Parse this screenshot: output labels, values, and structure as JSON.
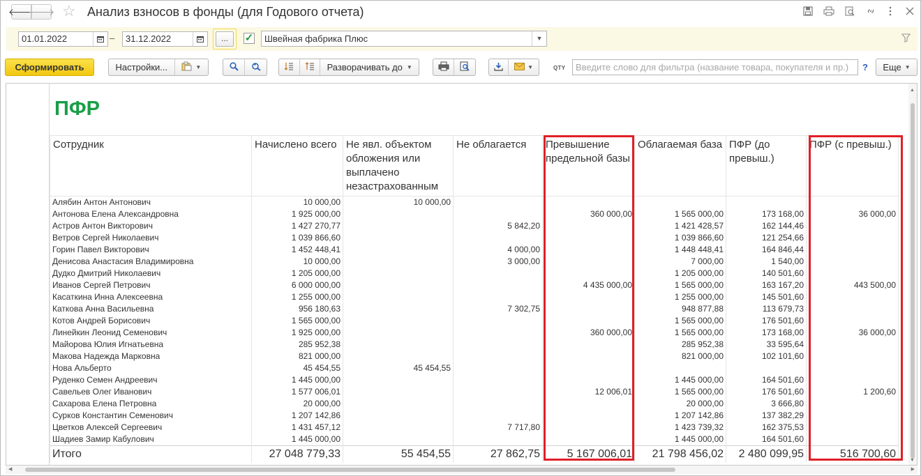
{
  "window": {
    "title": "Анализ взносов в фонды (для Годового отчета)",
    "back_glyph": "🡐",
    "forward_glyph": "🡒",
    "star_glyph": "☆",
    "icons": [
      "save-icon",
      "print-icon",
      "preview-icon",
      "link-icon",
      "more-icon",
      "close-icon"
    ]
  },
  "params": {
    "date_from": "01.01.2022",
    "date_to": "31.12.2022",
    "dash": "–",
    "dots_label": "...",
    "org_checked": "✓",
    "organization": "Швейная фабрика Плюс"
  },
  "toolbar": {
    "generate_label": "Сформировать",
    "settings_label": "Настройки...",
    "expand_label": "Разворачивать до",
    "qty_label": "QTY",
    "search_placeholder": "Введите слово для фильтра (название товара, покупателя и пр.)",
    "help_label": "?",
    "more_label": "Еще"
  },
  "report": {
    "section_title": "ПФР",
    "columns": [
      "Сотрудник",
      "Начислено всего",
      "Не явл. объектом обложения или выплачено незастрахованным",
      "Не облагается",
      "Превышение предельной базы",
      "Облагаемая база",
      "ПФР (до превыш.)",
      "ПФР (с превыш.)"
    ],
    "rows": [
      [
        "Алябин Антон Антонович",
        "10 000,00",
        "10 000,00",
        "",
        "",
        "",
        "",
        ""
      ],
      [
        "Антонова Елена Александровна",
        "1 925 000,00",
        "",
        "",
        "360 000,00",
        "1 565 000,00",
        "173 168,00",
        "36 000,00"
      ],
      [
        "Астров Антон Викторович",
        "1 427 270,77",
        "",
        "5 842,20",
        "",
        "1 421 428,57",
        "162 144,46",
        ""
      ],
      [
        "Ветров Сергей Николаевич",
        "1 039 866,60",
        "",
        "",
        "",
        "1 039 866,60",
        "121 254,66",
        ""
      ],
      [
        "Горин Павел Викторович",
        "1 452 448,41",
        "",
        "4 000,00",
        "",
        "1 448 448,41",
        "164 846,44",
        ""
      ],
      [
        "Денисова Анастасия Владимировна",
        "10 000,00",
        "",
        "3 000,00",
        "",
        "7 000,00",
        "1 540,00",
        ""
      ],
      [
        "Дудко Дмитрий Николаевич",
        "1 205 000,00",
        "",
        "",
        "",
        "1 205 000,00",
        "140 501,60",
        ""
      ],
      [
        "Иванов Сергей Петрович",
        "6 000 000,00",
        "",
        "",
        "4 435 000,00",
        "1 565 000,00",
        "163 167,20",
        "443 500,00"
      ],
      [
        "Касаткина Инна Алексеевна",
        "1 255 000,00",
        "",
        "",
        "",
        "1 255 000,00",
        "145 501,60",
        ""
      ],
      [
        "Каткова Анна Васильевна",
        "956 180,63",
        "",
        "7 302,75",
        "",
        "948 877,88",
        "113 679,73",
        ""
      ],
      [
        "Котов Андрей Борисович",
        "1 565 000,00",
        "",
        "",
        "",
        "1 565 000,00",
        "176 501,60",
        ""
      ],
      [
        "Линейкин Леонид Семенович",
        "1 925 000,00",
        "",
        "",
        "360 000,00",
        "1 565 000,00",
        "173 168,00",
        "36 000,00"
      ],
      [
        "Майорова Юлия Игнатьевна",
        "285 952,38",
        "",
        "",
        "",
        "285 952,38",
        "33 595,64",
        ""
      ],
      [
        "Макова Надежда Марковна",
        "821 000,00",
        "",
        "",
        "",
        "821 000,00",
        "102 101,60",
        ""
      ],
      [
        "Нова Альберто",
        "45 454,55",
        "45 454,55",
        "",
        "",
        "",
        "",
        ""
      ],
      [
        "Руденко Семен Андреевич",
        "1 445 000,00",
        "",
        "",
        "",
        "1 445 000,00",
        "164 501,60",
        ""
      ],
      [
        "Савельев Олег Иванович",
        "1 577 006,01",
        "",
        "",
        "12 006,01",
        "1 565 000,00",
        "176 501,60",
        "1 200,60"
      ],
      [
        "Сахарова Елена Петровна",
        "20 000,00",
        "",
        "",
        "",
        "20 000,00",
        "3 666,80",
        ""
      ],
      [
        "Сурков Константин Семенович",
        "1 207 142,86",
        "",
        "",
        "",
        "1 207 142,86",
        "137 382,29",
        ""
      ],
      [
        "Цветков Алексей Сергеевич",
        "1 431 457,12",
        "",
        "7 717,80",
        "",
        "1 423 739,32",
        "162 375,53",
        ""
      ],
      [
        "Шадиев Замир Кабулович",
        "1 445 000,00",
        "",
        "",
        "",
        "1 445 000,00",
        "164 501,60",
        ""
      ]
    ],
    "total": [
      "Итого",
      "27 048 779,33",
      "55 454,55",
      "27 862,75",
      "5 167 006,01",
      "21 798 456,02",
      "2 480 099,95",
      "516 700,60"
    ]
  }
}
